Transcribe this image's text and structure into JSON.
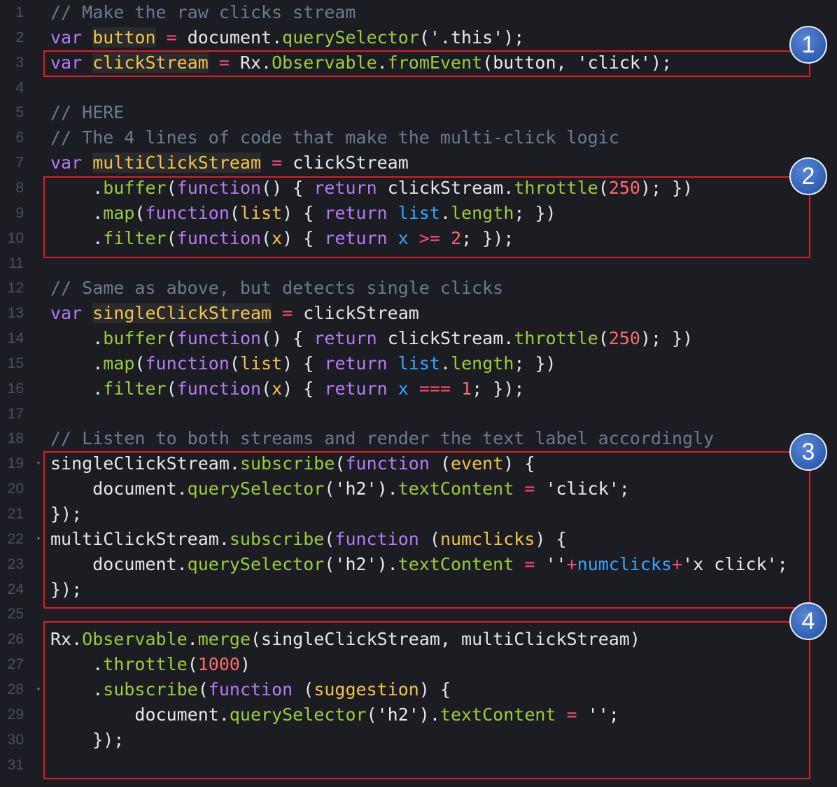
{
  "editor": {
    "lines": [
      {
        "n": "1",
        "fold": false,
        "tokens": [
          {
            "t": "// Make the raw clicks stream",
            "c": "comment"
          }
        ]
      },
      {
        "n": "2",
        "fold": false,
        "tokens": [
          {
            "t": "var",
            "c": "keyword"
          },
          {
            "t": " ",
            "c": "plain"
          },
          {
            "t": "button",
            "c": "var-hl"
          },
          {
            "t": " = ",
            "c": "op"
          },
          {
            "t": "document.",
            "c": "plain"
          },
          {
            "t": "querySelector",
            "c": "method"
          },
          {
            "t": "('.this');",
            "c": "string"
          }
        ]
      },
      {
        "n": "3",
        "fold": false,
        "tokens": [
          {
            "t": "var",
            "c": "keyword"
          },
          {
            "t": " ",
            "c": "plain"
          },
          {
            "t": "clickStream",
            "c": "var-hl"
          },
          {
            "t": " = ",
            "c": "op"
          },
          {
            "t": "Rx.",
            "c": "plain"
          },
          {
            "t": "Observable",
            "c": "method"
          },
          {
            "t": ".",
            "c": "plain"
          },
          {
            "t": "fromEvent",
            "c": "method"
          },
          {
            "t": "(button, 'click');",
            "c": "string"
          }
        ]
      },
      {
        "n": "4",
        "fold": false,
        "tokens": []
      },
      {
        "n": "5",
        "fold": false,
        "tokens": [
          {
            "t": "// HERE",
            "c": "comment"
          }
        ]
      },
      {
        "n": "6",
        "fold": false,
        "tokens": [
          {
            "t": "// The 4 lines of code that make the multi-click logic",
            "c": "comment"
          }
        ]
      },
      {
        "n": "7",
        "fold": false,
        "tokens": [
          {
            "t": "var",
            "c": "keyword"
          },
          {
            "t": " ",
            "c": "plain"
          },
          {
            "t": "multiClickStream",
            "c": "var-hl"
          },
          {
            "t": " = ",
            "c": "op"
          },
          {
            "t": "clickStream",
            "c": "plain"
          }
        ]
      },
      {
        "n": "8",
        "fold": false,
        "tokens": [
          {
            "t": "    .",
            "c": "plain"
          },
          {
            "t": "buffer",
            "c": "method"
          },
          {
            "t": "(",
            "c": "punct"
          },
          {
            "t": "function",
            "c": "keyword"
          },
          {
            "t": "() { ",
            "c": "punct"
          },
          {
            "t": "return",
            "c": "keyword"
          },
          {
            "t": " clickStream.",
            "c": "plain"
          },
          {
            "t": "throttle",
            "c": "method"
          },
          {
            "t": "(",
            "c": "punct"
          },
          {
            "t": "250",
            "c": "number"
          },
          {
            "t": "); })",
            "c": "punct"
          }
        ]
      },
      {
        "n": "9",
        "fold": false,
        "tokens": [
          {
            "t": "    .",
            "c": "plain"
          },
          {
            "t": "map",
            "c": "method"
          },
          {
            "t": "(",
            "c": "punct"
          },
          {
            "t": "function",
            "c": "keyword"
          },
          {
            "t": "(",
            "c": "punct"
          },
          {
            "t": "list",
            "c": "param"
          },
          {
            "t": ") { ",
            "c": "punct"
          },
          {
            "t": "return",
            "c": "keyword"
          },
          {
            "t": " ",
            "c": "plain"
          },
          {
            "t": "list",
            "c": "ident"
          },
          {
            "t": ".",
            "c": "plain"
          },
          {
            "t": "length",
            "c": "method"
          },
          {
            "t": "; })",
            "c": "punct"
          }
        ]
      },
      {
        "n": "10",
        "fold": false,
        "tokens": [
          {
            "t": "    .",
            "c": "plain"
          },
          {
            "t": "filter",
            "c": "method"
          },
          {
            "t": "(",
            "c": "punct"
          },
          {
            "t": "function",
            "c": "keyword"
          },
          {
            "t": "(",
            "c": "punct"
          },
          {
            "t": "x",
            "c": "param"
          },
          {
            "t": ") { ",
            "c": "punct"
          },
          {
            "t": "return",
            "c": "keyword"
          },
          {
            "t": " ",
            "c": "plain"
          },
          {
            "t": "x",
            "c": "ident"
          },
          {
            "t": " >= ",
            "c": "op"
          },
          {
            "t": "2",
            "c": "number"
          },
          {
            "t": "; });",
            "c": "punct"
          }
        ]
      },
      {
        "n": "11",
        "fold": false,
        "tokens": []
      },
      {
        "n": "12",
        "fold": false,
        "tokens": [
          {
            "t": "// Same as above, but detects single clicks",
            "c": "comment"
          }
        ]
      },
      {
        "n": "13",
        "fold": false,
        "tokens": [
          {
            "t": "var",
            "c": "keyword"
          },
          {
            "t": " ",
            "c": "plain"
          },
          {
            "t": "singleClickStream",
            "c": "var-hl"
          },
          {
            "t": " = ",
            "c": "op"
          },
          {
            "t": "clickStream",
            "c": "plain"
          }
        ]
      },
      {
        "n": "14",
        "fold": false,
        "tokens": [
          {
            "t": "    .",
            "c": "plain"
          },
          {
            "t": "buffer",
            "c": "method"
          },
          {
            "t": "(",
            "c": "punct"
          },
          {
            "t": "function",
            "c": "keyword"
          },
          {
            "t": "() { ",
            "c": "punct"
          },
          {
            "t": "return",
            "c": "keyword"
          },
          {
            "t": " clickStream.",
            "c": "plain"
          },
          {
            "t": "throttle",
            "c": "method"
          },
          {
            "t": "(",
            "c": "punct"
          },
          {
            "t": "250",
            "c": "number"
          },
          {
            "t": "); })",
            "c": "punct"
          }
        ]
      },
      {
        "n": "15",
        "fold": false,
        "tokens": [
          {
            "t": "    .",
            "c": "plain"
          },
          {
            "t": "map",
            "c": "method"
          },
          {
            "t": "(",
            "c": "punct"
          },
          {
            "t": "function",
            "c": "keyword"
          },
          {
            "t": "(",
            "c": "punct"
          },
          {
            "t": "list",
            "c": "param"
          },
          {
            "t": ") { ",
            "c": "punct"
          },
          {
            "t": "return",
            "c": "keyword"
          },
          {
            "t": " ",
            "c": "plain"
          },
          {
            "t": "list",
            "c": "ident"
          },
          {
            "t": ".",
            "c": "plain"
          },
          {
            "t": "length",
            "c": "method"
          },
          {
            "t": "; })",
            "c": "punct"
          }
        ]
      },
      {
        "n": "16",
        "fold": false,
        "tokens": [
          {
            "t": "    .",
            "c": "plain"
          },
          {
            "t": "filter",
            "c": "method"
          },
          {
            "t": "(",
            "c": "punct"
          },
          {
            "t": "function",
            "c": "keyword"
          },
          {
            "t": "(",
            "c": "punct"
          },
          {
            "t": "x",
            "c": "param"
          },
          {
            "t": ") { ",
            "c": "punct"
          },
          {
            "t": "return",
            "c": "keyword"
          },
          {
            "t": " ",
            "c": "plain"
          },
          {
            "t": "x",
            "c": "ident"
          },
          {
            "t": " === ",
            "c": "op"
          },
          {
            "t": "1",
            "c": "number"
          },
          {
            "t": "; });",
            "c": "punct"
          }
        ]
      },
      {
        "n": "17",
        "fold": false,
        "tokens": []
      },
      {
        "n": "18",
        "fold": false,
        "tokens": [
          {
            "t": "// Listen to both streams and render the text label accordingly",
            "c": "comment"
          }
        ]
      },
      {
        "n": "19",
        "fold": true,
        "tokens": [
          {
            "t": "singleClickStream.",
            "c": "plain"
          },
          {
            "t": "subscribe",
            "c": "method"
          },
          {
            "t": "(",
            "c": "punct"
          },
          {
            "t": "function",
            "c": "keyword"
          },
          {
            "t": " (",
            "c": "punct"
          },
          {
            "t": "event",
            "c": "param"
          },
          {
            "t": ") {",
            "c": "punct"
          }
        ]
      },
      {
        "n": "20",
        "fold": false,
        "tokens": [
          {
            "t": "    document.",
            "c": "plain"
          },
          {
            "t": "querySelector",
            "c": "method"
          },
          {
            "t": "('h2').",
            "c": "string"
          },
          {
            "t": "textContent",
            "c": "method"
          },
          {
            "t": " = ",
            "c": "op"
          },
          {
            "t": "'click';",
            "c": "string"
          }
        ]
      },
      {
        "n": "21",
        "fold": false,
        "tokens": [
          {
            "t": "});",
            "c": "punct"
          }
        ]
      },
      {
        "n": "22",
        "fold": true,
        "tokens": [
          {
            "t": "multiClickStream.",
            "c": "plain"
          },
          {
            "t": "subscribe",
            "c": "method"
          },
          {
            "t": "(",
            "c": "punct"
          },
          {
            "t": "function",
            "c": "keyword"
          },
          {
            "t": " (",
            "c": "punct"
          },
          {
            "t": "numclicks",
            "c": "param"
          },
          {
            "t": ") {",
            "c": "punct"
          }
        ]
      },
      {
        "n": "23",
        "fold": false,
        "tokens": [
          {
            "t": "    document.",
            "c": "plain"
          },
          {
            "t": "querySelector",
            "c": "method"
          },
          {
            "t": "('h2').",
            "c": "string"
          },
          {
            "t": "textContent",
            "c": "method"
          },
          {
            "t": " = ",
            "c": "op"
          },
          {
            "t": "''",
            "c": "string"
          },
          {
            "t": "+",
            "c": "op"
          },
          {
            "t": "numclicks",
            "c": "ident"
          },
          {
            "t": "+",
            "c": "op"
          },
          {
            "t": "'x click';",
            "c": "string"
          }
        ]
      },
      {
        "n": "24",
        "fold": false,
        "tokens": [
          {
            "t": "});",
            "c": "punct"
          }
        ]
      },
      {
        "n": "25",
        "fold": false,
        "tokens": []
      },
      {
        "n": "26",
        "fold": false,
        "tokens": [
          {
            "t": "Rx.",
            "c": "plain"
          },
          {
            "t": "Observable",
            "c": "method"
          },
          {
            "t": ".",
            "c": "plain"
          },
          {
            "t": "merge",
            "c": "method"
          },
          {
            "t": "(singleClickStream, multiClickStream)",
            "c": "plain"
          }
        ]
      },
      {
        "n": "27",
        "fold": false,
        "tokens": [
          {
            "t": "    .",
            "c": "plain"
          },
          {
            "t": "throttle",
            "c": "method"
          },
          {
            "t": "(",
            "c": "punct"
          },
          {
            "t": "1000",
            "c": "number"
          },
          {
            "t": ")",
            "c": "punct"
          }
        ]
      },
      {
        "n": "28",
        "fold": true,
        "tokens": [
          {
            "t": "    .",
            "c": "plain"
          },
          {
            "t": "subscribe",
            "c": "method"
          },
          {
            "t": "(",
            "c": "punct"
          },
          {
            "t": "function",
            "c": "keyword"
          },
          {
            "t": " (",
            "c": "punct"
          },
          {
            "t": "suggestion",
            "c": "param"
          },
          {
            "t": ") {",
            "c": "punct"
          }
        ]
      },
      {
        "n": "29",
        "fold": false,
        "tokens": [
          {
            "t": "        document.",
            "c": "plain"
          },
          {
            "t": "querySelector",
            "c": "method"
          },
          {
            "t": "('h2').",
            "c": "string"
          },
          {
            "t": "textContent",
            "c": "method"
          },
          {
            "t": " = ",
            "c": "op"
          },
          {
            "t": "'';",
            "c": "string"
          }
        ]
      },
      {
        "n": "30",
        "fold": false,
        "tokens": [
          {
            "t": "    });",
            "c": "punct"
          }
        ]
      },
      {
        "n": "31",
        "fold": false,
        "tokens": []
      }
    ],
    "fold_glyph": "▾"
  },
  "annotations": [
    {
      "label": "1"
    },
    {
      "label": "2"
    },
    {
      "label": "3"
    },
    {
      "label": "4"
    }
  ],
  "colors": {
    "background": "#1b1d23",
    "annotation_border": "#e01b24",
    "badge_fill": "#3b6cc0"
  }
}
